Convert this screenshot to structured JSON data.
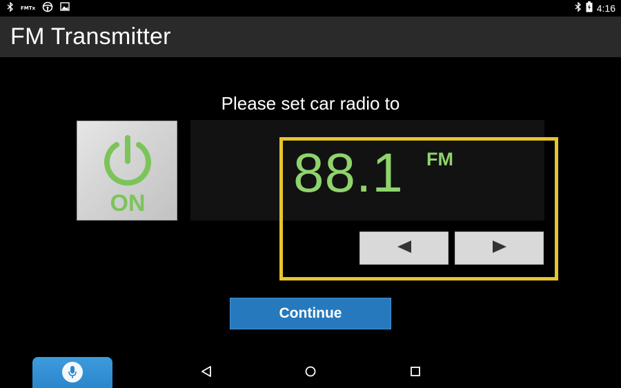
{
  "status_bar": {
    "left_icons": [
      "bluetooth-icon",
      "fmtx-notification-icon",
      "steering-wheel-icon",
      "image-icon"
    ],
    "fmtx_text": "FMTx",
    "right_icons": [
      "bluetooth-icon",
      "battery-charging-icon"
    ],
    "time": "4:16"
  },
  "action_bar": {
    "title": "FM Transmitter"
  },
  "main": {
    "prompt": "Please set car radio to",
    "power_button": {
      "label": "ON",
      "icon": "power-icon",
      "accent_color": "#7cc45a"
    },
    "frequency": {
      "value": "88.1",
      "band": "FM",
      "color": "#8fd36c"
    },
    "tune_down_icon": "left-arrow-icon",
    "tune_up_icon": "right-arrow-icon",
    "highlight_color": "#e7c52c",
    "continue_label": "Continue",
    "continue_color": "#2779bd"
  },
  "voice_tab": {
    "icon": "microphone-icon"
  },
  "nav_bar": {
    "back_icon": "back-icon",
    "home_icon": "home-icon",
    "recents_icon": "recents-icon"
  }
}
